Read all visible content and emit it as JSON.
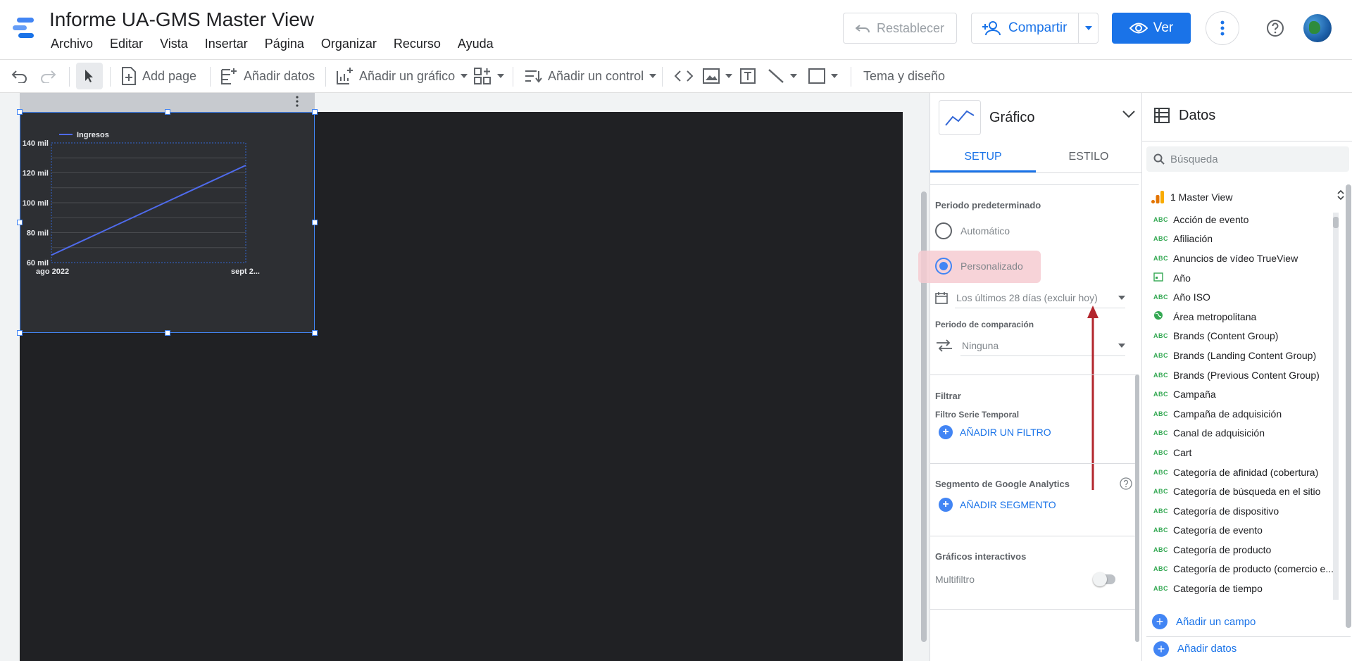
{
  "header": {
    "title": "Informe UA-GMS Master View",
    "menu": [
      "Archivo",
      "Editar",
      "Vista",
      "Insertar",
      "Página",
      "Organizar",
      "Recurso",
      "Ayuda"
    ],
    "reset_label": "Restablecer",
    "share_label": "Compartir",
    "view_label": "Ver"
  },
  "toolbar": {
    "add_page": "Add page",
    "add_data": "Añadir datos",
    "add_chart": "Añadir un gráfico",
    "add_control": "Añadir un control",
    "theme": "Tema y diseño"
  },
  "chart_data": {
    "type": "line",
    "x": [
      "ago 2022",
      "sept 2..."
    ],
    "series": [
      {
        "name": "Ingresos",
        "values": [
          65000,
          125000
        ],
        "color": "#4f6bed"
      }
    ],
    "yticks": [
      "140 mil",
      "120 mil",
      "100 mil",
      "80 mil",
      "60 mil"
    ],
    "ylim": [
      60000,
      140000
    ],
    "legend": "top-left",
    "grid": true
  },
  "props": {
    "title": "Gráfico",
    "tabs": [
      "SETUP",
      "ESTILO"
    ],
    "default_period_title": "Periodo predeterminado",
    "option_auto": "Automático",
    "option_custom": "Personalizado",
    "date_range": "Los últimos 28 días (excluir hoy)",
    "comparison_title": "Periodo de comparación",
    "comparison_value": "Ninguna",
    "filter_title": "Filtrar",
    "filter_sub": "Filtro Serie Temporal",
    "add_filter": "AÑADIR UN FILTRO",
    "segment_title": "Segmento de Google Analytics",
    "add_segment": "AÑADIR SEGMENTO",
    "interactive_title": "Gráficos interactivos",
    "multifilter": "Multifiltro"
  },
  "data_panel": {
    "title": "Datos",
    "search_placeholder": "Búsqueda",
    "source": "1 Master View",
    "fields": [
      {
        "type": "ABC",
        "name": "Acción de evento"
      },
      {
        "type": "ABC",
        "name": "Afiliación"
      },
      {
        "type": "ABC",
        "name": "Anuncios de vídeo TrueView"
      },
      {
        "type": "calendar-icon",
        "name": "Año"
      },
      {
        "type": "ABC",
        "name": "Año ISO"
      },
      {
        "type": "globe-icon",
        "name": "Área metropolitana"
      },
      {
        "type": "ABC",
        "name": "Brands (Content Group)"
      },
      {
        "type": "ABC",
        "name": "Brands (Landing Content Group)"
      },
      {
        "type": "ABC",
        "name": "Brands (Previous Content Group)"
      },
      {
        "type": "ABC",
        "name": "Campaña"
      },
      {
        "type": "ABC",
        "name": "Campaña de adquisición"
      },
      {
        "type": "ABC",
        "name": "Canal de adquisición"
      },
      {
        "type": "ABC",
        "name": "Cart"
      },
      {
        "type": "ABC",
        "name": "Categoría de afinidad (cobertura)"
      },
      {
        "type": "ABC",
        "name": "Categoría de búsqueda en el sitio"
      },
      {
        "type": "ABC",
        "name": "Categoría de dispositivo"
      },
      {
        "type": "ABC",
        "name": "Categoría de evento"
      },
      {
        "type": "ABC",
        "name": "Categoría de producto"
      },
      {
        "type": "ABC",
        "name": "Categoría de producto (comercio e..."
      },
      {
        "type": "ABC",
        "name": "Categoría de tiempo"
      }
    ],
    "add_field": "Añadir un campo",
    "add_data": "Añadir datos"
  },
  "colors": {
    "accent": "#1a73e8",
    "canvas": "#202124",
    "line": "#4f6bed",
    "annotation": "#b3262d"
  }
}
